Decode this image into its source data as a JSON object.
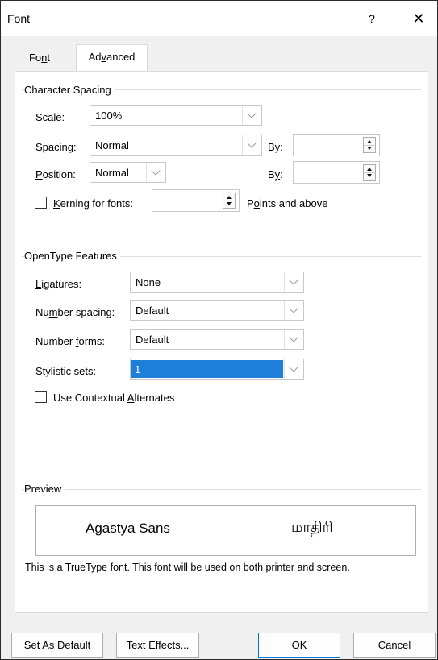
{
  "window": {
    "title": "Font",
    "help_label": "?",
    "close_label": "✕"
  },
  "tabs": {
    "font": {
      "pre": "Fo",
      "key": "n",
      "post": "t"
    },
    "advanced": {
      "pre": "Ad",
      "key": "v",
      "post": "anced"
    }
  },
  "character_spacing": {
    "title": "Character Spacing",
    "scale": {
      "label_pre": "S",
      "label_key": "c",
      "label_post": "ale:",
      "value": "100%"
    },
    "spacing": {
      "label_pre": "",
      "label_key": "S",
      "label_post": "pacing:",
      "value": "Normal",
      "by_pre": "",
      "by_key": "B",
      "by_post": "y:",
      "by_value": ""
    },
    "position": {
      "label_pre": "",
      "label_key": "P",
      "label_post": "osition:",
      "value": "Normal",
      "by_pre": "B",
      "by_key": "y",
      "by_post": ":",
      "by_value": ""
    },
    "kerning": {
      "label_pre": "",
      "label_key": "K",
      "label_post": "erning for fonts:",
      "value": "",
      "suffix_pre": "P",
      "suffix_key": "o",
      "suffix_post": "ints and above",
      "checked": false
    }
  },
  "opentype": {
    "title": "OpenType Features",
    "ligatures": {
      "label_pre": "",
      "label_key": "L",
      "label_post": "igatures:",
      "value": "None"
    },
    "number_spacing": {
      "label_pre": "Nu",
      "label_key": "m",
      "label_post": "ber spacing:",
      "value": "Default"
    },
    "number_forms": {
      "label_pre": "Number ",
      "label_key": "f",
      "label_post": "orms:",
      "value": "Default"
    },
    "stylistic_sets": {
      "label_pre": "S",
      "label_key": "t",
      "label_post": "ylistic sets:",
      "value": "1"
    },
    "contextual": {
      "label_pre": "Use Contextual ",
      "label_key": "A",
      "label_post": "lternates",
      "checked": false
    }
  },
  "preview": {
    "title": "Preview",
    "sample_latin": "Agastya Sans",
    "sample_tamil": "மாதிரி",
    "description": "This is a TrueType font. This font will be used on both printer and screen."
  },
  "buttons": {
    "set_default": {
      "pre": "Set As ",
      "key": "D",
      "post": "efault"
    },
    "text_effects": {
      "pre": "Text ",
      "key": "E",
      "post": "ffects..."
    },
    "ok": "OK",
    "cancel": "Cancel"
  },
  "colors": {
    "selection": "#1e7fd8",
    "default_button_border": "#0078d7"
  }
}
